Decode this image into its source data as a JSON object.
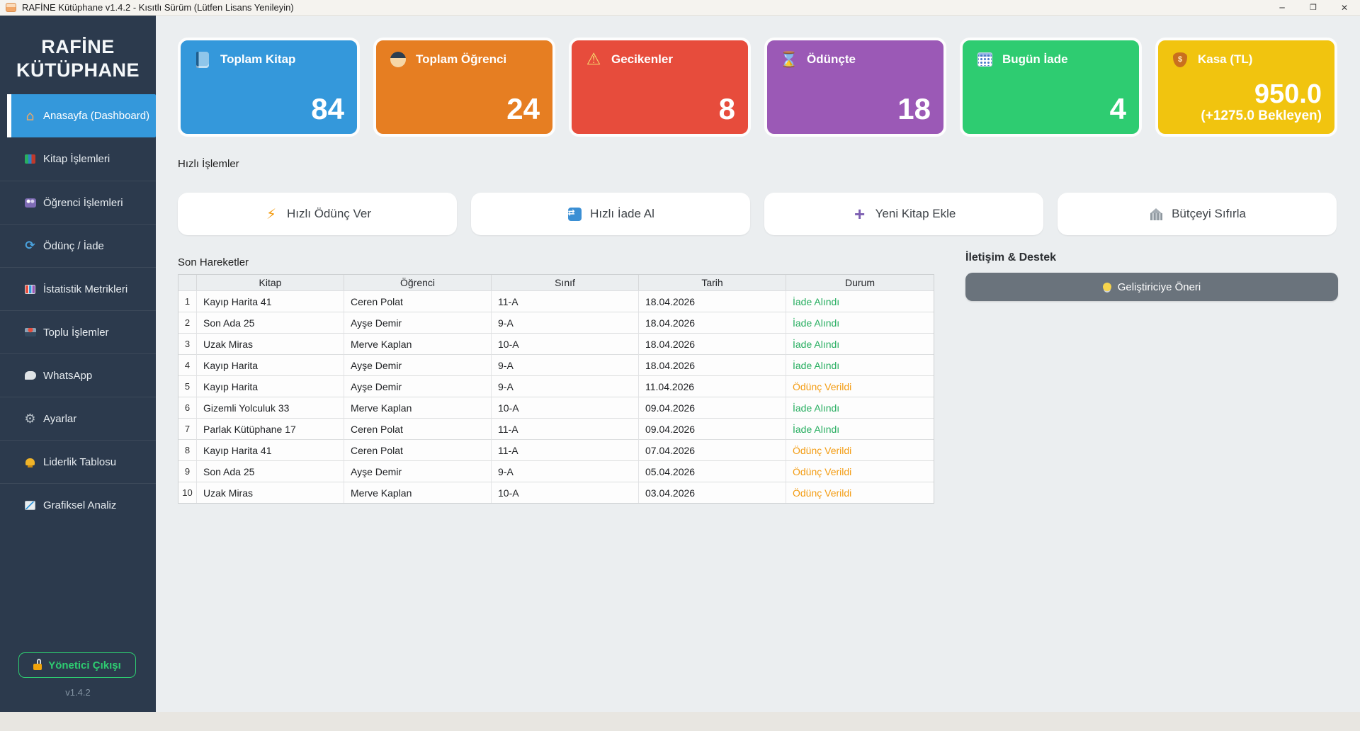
{
  "window": {
    "title": "RAFİNE Kütüphane v1.4.2 - Kısıtlı Sürüm (Lütfen Lisans Yenileyin)",
    "controls": [
      "minimize-icon",
      "maximize-icon",
      "close-icon"
    ]
  },
  "sidebar": {
    "title": "RAFİNE KÜTÜPHANE",
    "items": [
      {
        "icon": "home-icon",
        "label": "Anasayfa (Dashboard)",
        "active": true
      },
      {
        "icon": "books-icon",
        "label": "Kitap İşlemleri"
      },
      {
        "icon": "people-icon",
        "label": "Öğrenci İşlemleri"
      },
      {
        "icon": "refresh-icon",
        "label": "Ödünç / İade"
      },
      {
        "icon": "chart-icon",
        "label": "İstatistik Metrikleri"
      },
      {
        "icon": "inbox-icon",
        "label": "Toplu İşlemler"
      },
      {
        "icon": "chat-icon",
        "label": "WhatsApp"
      },
      {
        "icon": "gear-icon",
        "label": "Ayarlar"
      },
      {
        "icon": "trophy-icon",
        "label": "Liderlik Tablosu"
      },
      {
        "icon": "graph-icon",
        "label": "Grafiksel Analiz"
      }
    ],
    "logout": {
      "icon": "unlock-icon",
      "label": "Yönetici Çıkışı",
      "color": "#2ecc71"
    },
    "version": "v1.4.2"
  },
  "stats": [
    {
      "icon": "book-icon",
      "label": "Toplam Kitap",
      "value": "84",
      "color": "#3498db"
    },
    {
      "icon": "student-icon",
      "label": "Toplam Öğrenci",
      "value": "24",
      "color": "#e67e22"
    },
    {
      "icon": "warning-icon",
      "label": "Gecikenler",
      "value": "8",
      "color": "#e74c3c"
    },
    {
      "icon": "hourglass-icon",
      "label": "Ödünçte",
      "value": "18",
      "color": "#9b59b6"
    },
    {
      "icon": "calendar-icon",
      "label": "Bugün İade",
      "value": "4",
      "color": "#2ecc71"
    },
    {
      "icon": "moneybag-icon",
      "label": "Kasa (TL)",
      "value": "950.0",
      "subvalue": "(+1275.0 Bekleyen)",
      "color": "#f1c40f"
    }
  ],
  "quick_actions": {
    "section_label": "Hızlı İşlemler",
    "buttons": [
      {
        "icon": "lightning-icon",
        "label": "Hızlı Ödünç Ver"
      },
      {
        "icon": "return-icon",
        "label": "Hızlı İade Al"
      },
      {
        "icon": "plus-icon",
        "label": "Yeni Kitap Ekle"
      },
      {
        "icon": "bank-icon",
        "label": "Bütçeyi Sıfırla"
      }
    ]
  },
  "recent": {
    "section_label": "Son Hareketler",
    "columns": [
      "Kitap",
      "Öğrenci",
      "Sınıf",
      "Tarih",
      "Durum"
    ],
    "status_colors": {
      "returned": "#27ae60",
      "lent": "#f39c12"
    },
    "rows": [
      [
        "1",
        "Kayıp Harita 41",
        "Ceren Polat",
        "11-A",
        "18.04.2026",
        "İade Alındı"
      ],
      [
        "2",
        "Son Ada 25",
        "Ayşe Demir",
        "9-A",
        "18.04.2026",
        "İade Alındı"
      ],
      [
        "3",
        "Uzak Miras",
        "Merve Kaplan",
        "10-A",
        "18.04.2026",
        "İade Alındı"
      ],
      [
        "4",
        "Kayıp Harita",
        "Ayşe Demir",
        "9-A",
        "18.04.2026",
        "İade Alındı"
      ],
      [
        "5",
        "Kayıp Harita",
        "Ayşe Demir",
        "9-A",
        "11.04.2026",
        "Ödünç Verildi"
      ],
      [
        "6",
        "Gizemli Yolculuk 33",
        "Merve Kaplan",
        "10-A",
        "09.04.2026",
        "İade Alındı"
      ],
      [
        "7",
        "Parlak Kütüphane 17",
        "Ceren Polat",
        "11-A",
        "09.04.2026",
        "İade Alındı"
      ],
      [
        "8",
        "Kayıp Harita 41",
        "Ceren Polat",
        "11-A",
        "07.04.2026",
        "Ödünç Verildi"
      ],
      [
        "9",
        "Son Ada 25",
        "Ayşe Demir",
        "9-A",
        "05.04.2026",
        "Ödünç Verildi"
      ],
      [
        "10",
        "Uzak Miras",
        "Merve Kaplan",
        "10-A",
        "03.04.2026",
        "Ödünç Verildi"
      ]
    ]
  },
  "support": {
    "section_label": "İletişim & Destek",
    "button": {
      "icon": "bulb-icon",
      "label": "Geliştiriciye Öneri"
    }
  }
}
